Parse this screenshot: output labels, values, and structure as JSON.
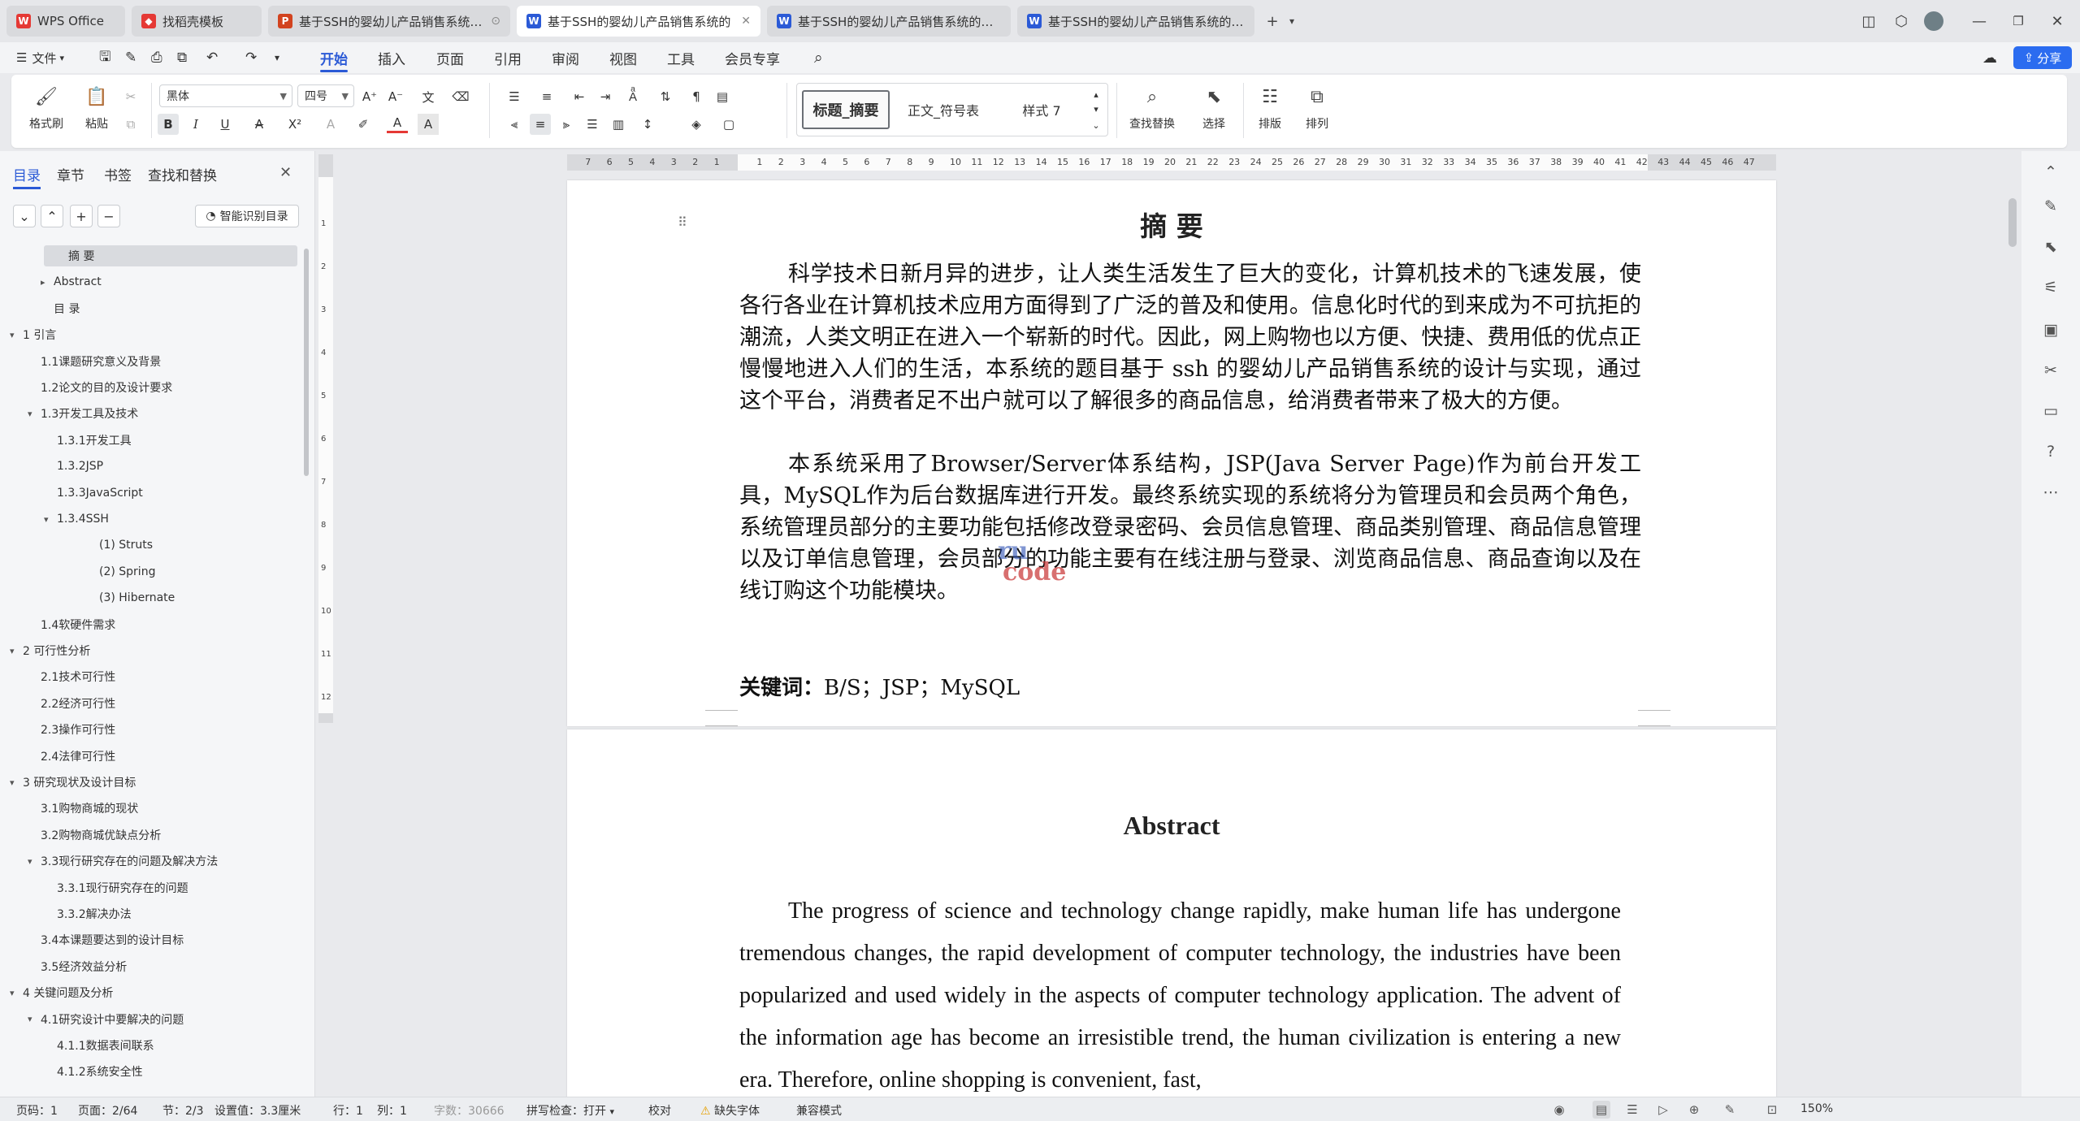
{
  "tabs": [
    {
      "label": "WPS Office",
      "icon": "wps-logo-icon"
    },
    {
      "label": "找稻壳模板",
      "icon": "docer-icon"
    },
    {
      "label": "基于SSH的婴幼儿产品销售系统的设",
      "icon": "ppt-icon"
    },
    {
      "label": "基于SSH的婴幼儿产品销售系统的",
      "icon": "word-icon"
    },
    {
      "label": "基于SSH的婴幼儿产品销售系统的开发",
      "icon": "word-icon"
    },
    {
      "label": "基于SSH的婴幼儿产品销售系统的开发",
      "icon": "word-icon"
    }
  ],
  "tab_icon_letters": {
    "ppt": "P",
    "word": "W"
  },
  "menu": {
    "file": "文件",
    "items": [
      "开始",
      "插入",
      "页面",
      "引用",
      "审阅",
      "视图",
      "工具",
      "会员专享"
    ],
    "active": "开始",
    "share": "分享"
  },
  "ribbon": {
    "format_painter": "格式刷",
    "paste": "粘贴",
    "font_name": "黑体",
    "font_size": "四号",
    "styles": [
      "标题_摘要",
      "正文_符号表",
      "样式 7"
    ],
    "find_replace": "查找替换",
    "select": "选择",
    "layout": "排版",
    "arrange": "排列",
    "bold": "B",
    "italic": "I",
    "underline": "U",
    "strike": "A",
    "superscript": "X²",
    "font_color": "A"
  },
  "nav": {
    "tabs": [
      "目录",
      "章节",
      "书签",
      "查找和替换"
    ],
    "active_tab": "目录",
    "smart_toc": "智能识别目录",
    "toc": [
      {
        "label": "摘  要",
        "level": 0,
        "caret": "",
        "selected": true
      },
      {
        "label": "Abstract",
        "level": 0,
        "caret": "▸"
      },
      {
        "label": "目  录",
        "level": 0,
        "caret": ""
      },
      {
        "label": "1   引言",
        "level": -1,
        "caret": "▾"
      },
      {
        "label": "1.1课题研究意义及背景",
        "level": 1,
        "caret": ""
      },
      {
        "label": "1.2论文的目的及设计要求",
        "level": 1,
        "caret": ""
      },
      {
        "label": "1.3开发工具及技术",
        "level": 1,
        "caret": "▾"
      },
      {
        "label": "1.3.1开发工具",
        "level": 2,
        "caret": ""
      },
      {
        "label": "1.3.2JSP",
        "level": 2,
        "caret": ""
      },
      {
        "label": "1.3.3JavaScript",
        "level": 2,
        "caret": ""
      },
      {
        "label": "1.3.4SSH",
        "level": 2,
        "caret": "▾"
      },
      {
        "label": "(1)  Struts",
        "level": 3,
        "caret": ""
      },
      {
        "label": "(2)  Spring",
        "level": 3,
        "caret": ""
      },
      {
        "label": "(3)  Hibernate",
        "level": 3,
        "caret": ""
      },
      {
        "label": "1.4软硬件需求",
        "level": 1,
        "caret": ""
      },
      {
        "label": "2   可行性分析",
        "level": -1,
        "caret": "▾"
      },
      {
        "label": "2.1技术可行性",
        "level": 1,
        "caret": ""
      },
      {
        "label": "2.2经济可行性",
        "level": 1,
        "caret": ""
      },
      {
        "label": "2.3操作可行性",
        "level": 1,
        "caret": ""
      },
      {
        "label": "2.4法律可行性",
        "level": 1,
        "caret": ""
      },
      {
        "label": "3   研究现状及设计目标",
        "level": -1,
        "caret": "▾"
      },
      {
        "label": "3.1购物商城的现状",
        "level": 1,
        "caret": ""
      },
      {
        "label": "3.2购物商城优缺点分析",
        "level": 1,
        "caret": ""
      },
      {
        "label": "3.3现行研究存在的问题及解决方法",
        "level": 1,
        "caret": "▾"
      },
      {
        "label": "3.3.1现行研究存在的问题",
        "level": 2,
        "caret": ""
      },
      {
        "label": "3.3.2解决办法",
        "level": 2,
        "caret": ""
      },
      {
        "label": "3.4本课题要达到的设计目标",
        "level": 1,
        "caret": ""
      },
      {
        "label": "3.5经济效益分析",
        "level": 1,
        "caret": ""
      },
      {
        "label": "4   关键问题及分析",
        "level": -1,
        "caret": "▾"
      },
      {
        "label": "4.1研究设计中要解决的问题",
        "level": 1,
        "caret": "▾"
      },
      {
        "label": "4.1.1数据表间联系",
        "level": 2,
        "caret": ""
      },
      {
        "label": "4.1.2系统安全性",
        "level": 2,
        "caret": ""
      }
    ]
  },
  "ruler": {
    "left_labels": [
      "7",
      "6",
      "5",
      "4",
      "3",
      "2",
      "1"
    ],
    "right_labels": [
      "1",
      "2",
      "3",
      "4",
      "5",
      "6",
      "7",
      "8",
      "9",
      "10",
      "11",
      "12",
      "13",
      "14",
      "15",
      "16",
      "17",
      "18",
      "19",
      "20",
      "21",
      "22",
      "23",
      "24",
      "25",
      "26",
      "27",
      "28",
      "29",
      "30",
      "31",
      "32",
      "33",
      "34",
      "35",
      "36",
      "37",
      "38",
      "39",
      "40",
      "41",
      "42",
      "43",
      "44",
      "45",
      "46",
      "47"
    ],
    "vertical_labels": [
      "1",
      "2",
      "3",
      "4",
      "5",
      "6",
      "7",
      "8",
      "9",
      "10",
      "11",
      "12"
    ]
  },
  "doc": {
    "abstract_zh_title": "摘  要",
    "zh_para1": "科学技术日新月异的进步，让人类生活发生了巨大的变化，计算机技术的飞速发展，使各行各业在计算机技术应用方面得到了广泛的普及和使用。信息化时代的到来成为不可抗拒的潮流，人类文明正在进入一个崭新的时代。因此，网上购物也以方便、快捷、费用低的优点正慢慢地进入人们的生活，本系统的题目基于 ssh 的婴幼儿产品销售系统的设计与实现，通过这个平台，消费者足不出户就可以了解很多的商品信息，给消费者带来了极大的方便。",
    "zh_para2": "本系统采用了Browser/Server体系结构，JSP(Java Server Page)作为前台开发工具，MySQL作为后台数据库进行开发。最终系统实现的系统将分为管理员和会员两个角色，系统管理员部分的主要功能包括修改登录密码、会员信息管理、商品类别管理、商品信息管理以及订单信息管理，会员部分的功能主要有在线注册与登录、浏览商品信息、商品查询以及在线订购这个功能模块。",
    "keywords_label": "关键词：",
    "keywords": "B/S；JSP；MySQL",
    "abstract_en_title": "Abstract",
    "en_para": "The progress of science and technology change rapidly, make human life has undergone tremendous changes, the rapid development of computer technology, the industries have been popularized and used widely in the aspects of computer technology application. The advent of the information age has become an irresistible trend, the human civilization is entering a new era. Therefore, online shopping is convenient, fast,",
    "watermark_line1": "ru",
    "watermark_line2": "code"
  },
  "status": {
    "page_code": "页码：1",
    "page": "页面：2/64",
    "section": "节：2/3",
    "setting": "设置值：3.3厘米",
    "row": "行：1",
    "col": "列：1",
    "word_count": "字数：30666",
    "spell": "拼写检查：打开",
    "proof": "校对",
    "missing_font": "缺失字体",
    "compat": "兼容模式",
    "zoom": "150%"
  },
  "colors": {
    "accent": "#2b5ad6",
    "share": "#2b6cf0"
  }
}
